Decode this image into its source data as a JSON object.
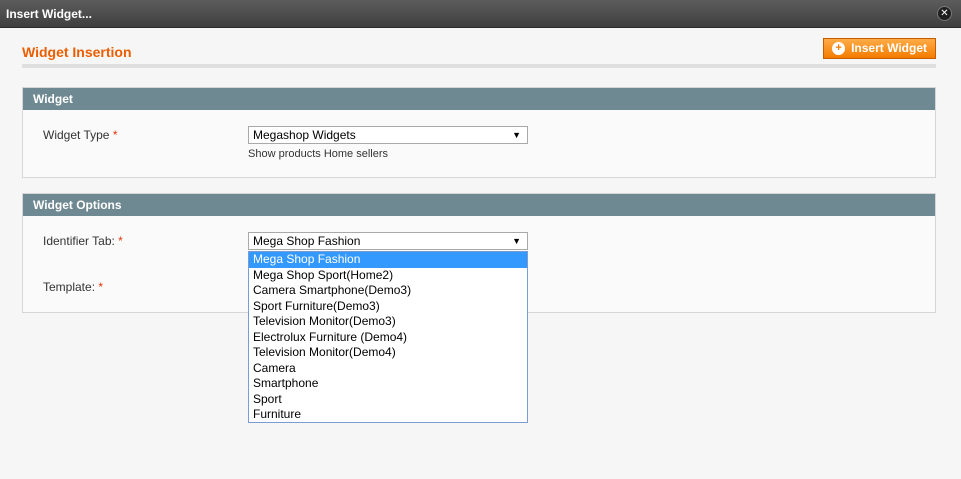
{
  "window": {
    "title": "Insert Widget...",
    "close_symbol": "✕"
  },
  "header": {
    "title": "Widget Insertion",
    "insert_button_label": "Insert Widget"
  },
  "widget_section": {
    "heading": "Widget",
    "type_label": "Widget Type",
    "required_mark": "*",
    "type_value": "Megashop Widgets",
    "type_note": "Show products Home sellers"
  },
  "options_section": {
    "heading": "Widget Options",
    "identifier_label": "Identifier Tab:",
    "template_label": "Template:",
    "required_mark": "*",
    "identifier_value": "Mega Shop Fashion",
    "dropdown_options": [
      "Mega Shop Fashion",
      "Mega Shop Sport(Home2)",
      "Camera Smartphone(Demo3)",
      "Sport Furniture(Demo3)",
      "Television Monitor(Demo3)",
      "Electrolux Furniture (Demo4)",
      "Television Monitor(Demo4)",
      "Camera",
      "Smartphone",
      "Sport",
      "Furniture"
    ],
    "selected_index": 0
  },
  "colors": {
    "accent": "#eb5e00",
    "section_header": "#6f8992",
    "selected_option": "#3399ff"
  }
}
